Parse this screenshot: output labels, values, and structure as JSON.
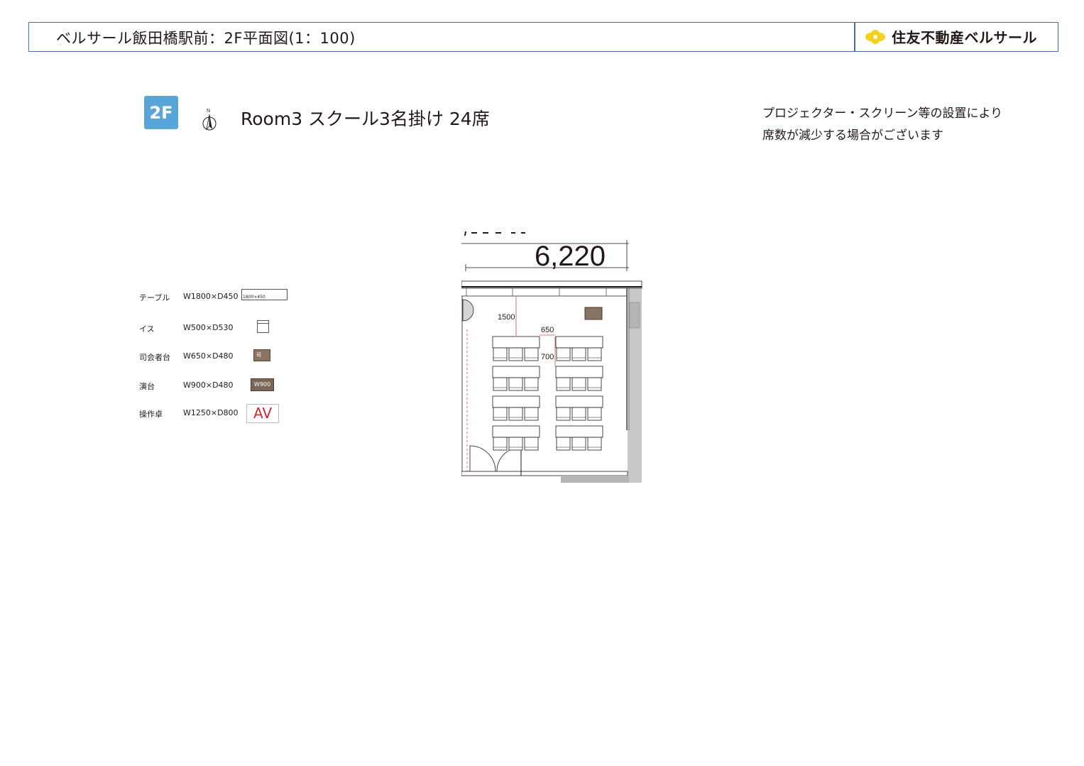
{
  "header": {
    "title": "ベルサール飯田橋駅前：2F平面図(1：100)",
    "brand": "住友不動産ベルサール"
  },
  "floor_badge": "2F",
  "north_label": "N",
  "room_title": "Room3 スクール3名掛け 24席",
  "note": {
    "line1": "プロジェクター・スクリーン等の設置により",
    "line2": "席数が減少する場合がございます"
  },
  "legend": [
    {
      "name": "テーブル",
      "dims": "W1800×D450",
      "icon_label": "1800×450",
      "icon": "table-icon"
    },
    {
      "name": "イス",
      "dims": "W500×D530",
      "icon_label": "",
      "icon": "chair-icon"
    },
    {
      "name": "司会者台",
      "dims": "W650×D480",
      "icon_label": "司",
      "icon": "mc-podium-icon"
    },
    {
      "name": "演台",
      "dims": "W900×D480",
      "icon_label": "W900",
      "icon": "lectern-icon"
    },
    {
      "name": "操作卓",
      "dims": "W1250×D800",
      "icon_label": "AV",
      "icon": "av-console-icon"
    }
  ],
  "plan": {
    "width_dim": "6,220",
    "dim_1500": "1500",
    "dim_650": "650",
    "dim_700": "700"
  },
  "colors": {
    "header_border": "#3f6fb5",
    "badge": "#5aa5d8",
    "podium": "#8b7362",
    "av_red": "#d1282e",
    "wall_gray": "#b5b5b5",
    "dim_red": "#d84b4b"
  }
}
